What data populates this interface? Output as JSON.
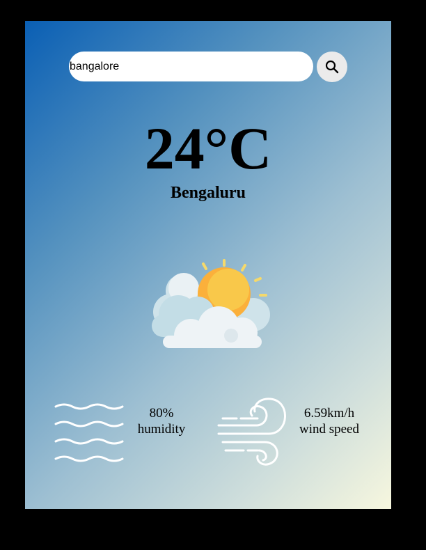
{
  "search": {
    "value": "bangalore",
    "icon": "search-icon"
  },
  "weather": {
    "temperature": "24°C",
    "city": "Bengaluru",
    "condition_icon": "partly-cloudy-icon"
  },
  "details": {
    "humidity": {
      "value": "80%",
      "label": "humidity",
      "icon": "humidity-waves-icon"
    },
    "wind": {
      "value": "6.59km/h",
      "label": "wind speed",
      "icon": "wind-icon"
    }
  },
  "colors": {
    "gradient_start": "#0a5fb4",
    "gradient_end": "#f7f7de",
    "sun": "#fbb03b",
    "cloud": "#eef3f6"
  }
}
